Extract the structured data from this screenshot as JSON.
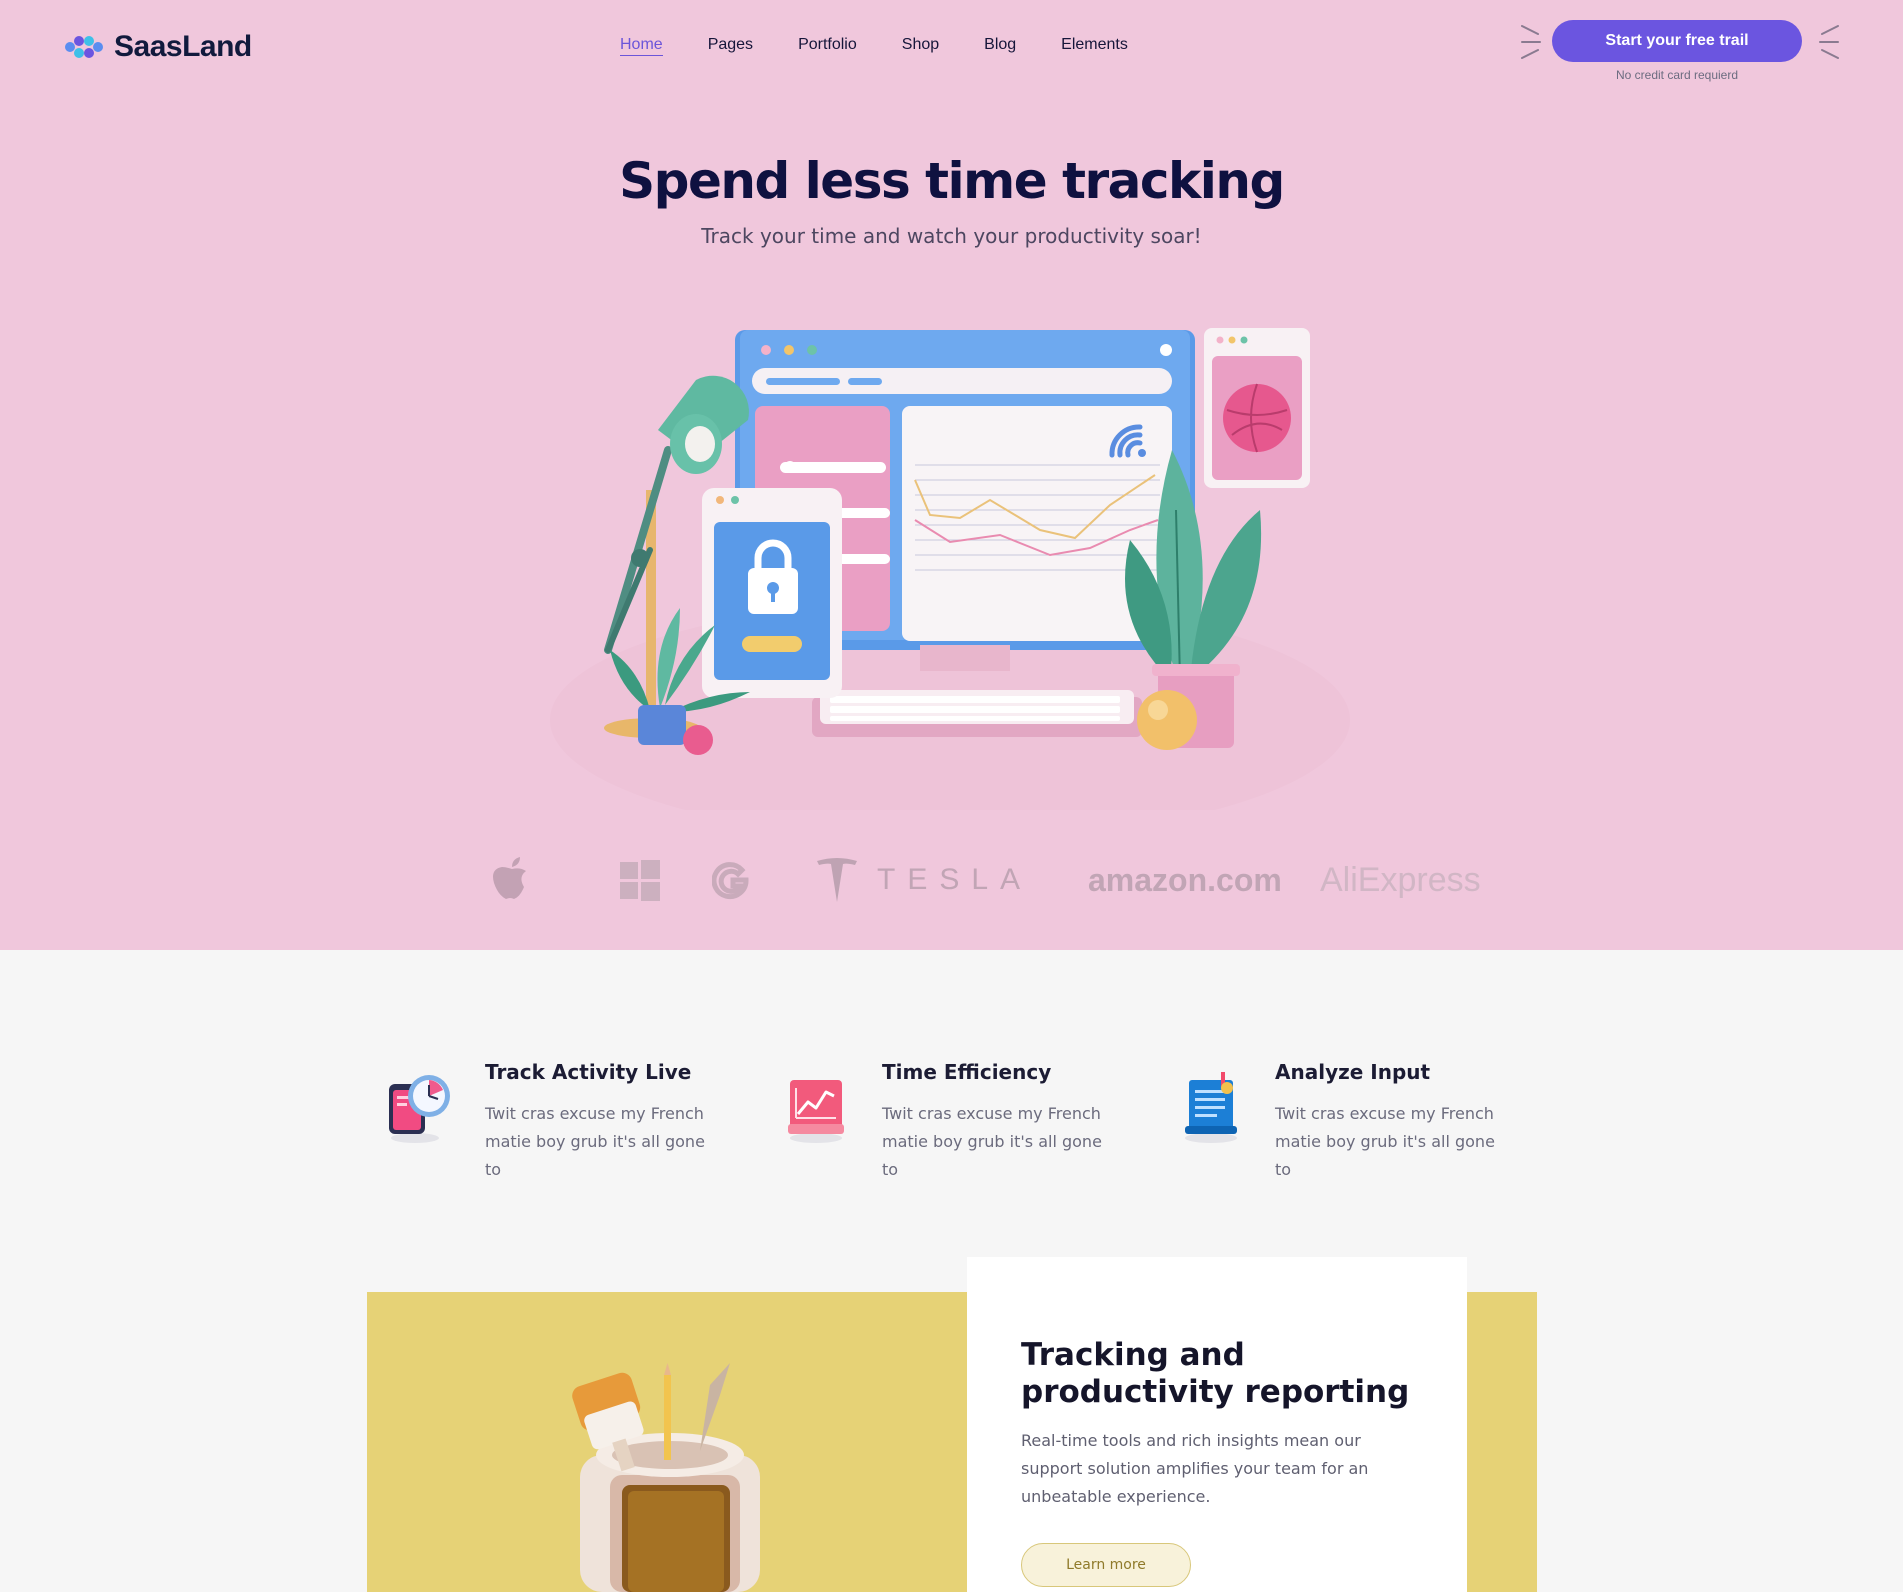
{
  "header": {
    "logo_text": "SaasLand",
    "nav": [
      "Home",
      "Pages",
      "Portfolio",
      "Shop",
      "Blog",
      "Elements"
    ],
    "cta_label": "Start your free trail",
    "cta_note": "No credit card requierd"
  },
  "hero": {
    "title": "Spend less time tracking",
    "subtitle": "Track your time and watch your productivity soar!"
  },
  "brands": [
    "apple-logo",
    "windows-logo",
    "google-logo",
    "tesla-logo",
    "amazon-logo",
    "aliexpress-logo"
  ],
  "brand_text": {
    "tesla": "TESLA",
    "amazon": "amazon.com",
    "aliexpress": "AliExpress"
  },
  "features": [
    {
      "title": "Track Activity Live",
      "desc": "Twit cras excuse my French matie boy grub it's all gone to",
      "icon": "clock-phone-icon"
    },
    {
      "title": "Time Efficiency",
      "desc": "Twit cras excuse my French matie boy grub it's all gone to",
      "icon": "chart-board-icon"
    },
    {
      "title": "Analyze Input",
      "desc": "Twit cras excuse my French matie boy grub it's all gone to",
      "icon": "document-icon"
    }
  ],
  "reporting": {
    "title": "Tracking and productivity reporting",
    "desc": "Real-time tools and rich insights mean our support solution amplifies your team for an unbeatable experience.",
    "button": "Learn more"
  },
  "colors": {
    "hero_bg": "#f0c7dc",
    "accent": "#6b55e0",
    "section_bg": "#f6f6f6",
    "yellow": "#e6d276"
  }
}
